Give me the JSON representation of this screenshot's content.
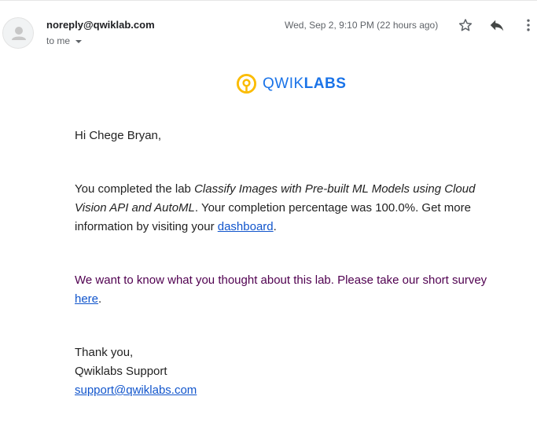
{
  "email": {
    "sender": "noreply@qwiklab.com",
    "recipient": "to me",
    "date": "Wed, Sep 2, 9:10 PM (22 hours ago)"
  },
  "logo": {
    "part1": "QWIK",
    "part2": "LABS"
  },
  "body": {
    "greeting": "Hi Chege Bryan,",
    "p1_before": "You completed the lab ",
    "p1_lab": "Classify Images with Pre-built ML Models using Cloud Vision API and AutoML",
    "p1_after": ". Your completion percentage was 100.0%. Get more information by visiting your ",
    "p1_link": "dashboard",
    "p1_end": ".",
    "p2_text": "We want to know what you thought about this lab. Please take our short survey ",
    "p2_link": "here",
    "p2_end": ".",
    "closing": "Thank you,",
    "signature": "Qwiklabs Support",
    "support_email": "support@qwiklabs.com"
  },
  "colors": {
    "link": "#1155cc",
    "purple_text": "#500050",
    "logo_blue": "#1a73e8",
    "logo_yellow": "#fbbc04"
  },
  "icons": [
    "avatar-icon",
    "star-icon",
    "reply-icon",
    "more-vert-icon",
    "chevron-down-icon"
  ]
}
